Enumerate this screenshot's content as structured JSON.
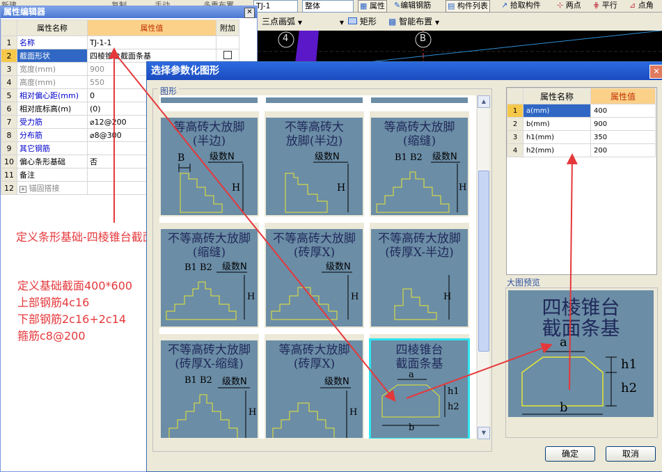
{
  "topbar": {
    "combo1": "TJ-1",
    "combo2": "整体",
    "attr_btn": "属性",
    "edit_rebar_btn": "编辑钢筋",
    "component_list_btn": "构件列表",
    "pick_component_btn": "拾取构件",
    "two_point_btn": "两点",
    "parallel_btn": "平行",
    "point_angle_btn": "点角",
    "left_partial": "新建",
    "col_partial_a": "复制",
    "col_partial_b": "手动",
    "col_partial_c": "多重布置"
  },
  "toolbar2": {
    "arc_combo": "三点画弧",
    "blank_combo": "",
    "rect_btn": "矩形",
    "smart_layout_btn": "智能布置"
  },
  "canvas": {
    "axis_a": "4",
    "axis_b": "B"
  },
  "prop_editor": {
    "title": "属性编辑器",
    "col_name": "属性名称",
    "col_value": "属性值",
    "col_extra": "附加",
    "rows": [
      {
        "n": "1",
        "name": "名称",
        "value": "TJ-1-1"
      },
      {
        "n": "2",
        "name": "截面形状",
        "value": "四棱锥台截面条基"
      },
      {
        "n": "3",
        "name": "宽度(mm)",
        "value": "900"
      },
      {
        "n": "4",
        "name": "高度(mm)",
        "value": "550"
      },
      {
        "n": "5",
        "name": "相对偏心距(mm)",
        "value": "0"
      },
      {
        "n": "6",
        "name": "相对底标高(m)",
        "value": "(0)"
      },
      {
        "n": "7",
        "name": "受力筋",
        "value": "⌀12@200"
      },
      {
        "n": "8",
        "name": "分布筋",
        "value": "⌀8@300"
      },
      {
        "n": "9",
        "name": "其它钢筋",
        "value": ""
      },
      {
        "n": "10",
        "name": "偏心条形基础",
        "value": "否"
      },
      {
        "n": "11",
        "name": "备注",
        "value": ""
      },
      {
        "n": "12",
        "name": "锚固搭接",
        "value": ""
      }
    ]
  },
  "notes": {
    "line1": "定义条形基础-四棱锥台截面条基",
    "line2": "定义基础截面400*600",
    "line3": "上部钢筋4c16",
    "line4": "下部钢筋2c16+2c14",
    "line5": "箍筋c8@200"
  },
  "dialog": {
    "title": "选择参数化图形",
    "group_label": "图形",
    "preview_label": "大图预览",
    "ok_btn": "确定",
    "cancel_btn": "取消",
    "shapes": [
      {
        "cap": "等高砖大放脚\n(半边)",
        "b": "B",
        "n": "级数N",
        "h": "H"
      },
      {
        "cap": "不等高砖大\n放脚(半边)",
        "b": "",
        "n": "级数N",
        "h": "H"
      },
      {
        "cap": "等高砖大放脚\n(缩缝)",
        "b": "B1 B2",
        "n": "级数N",
        "h": "H"
      },
      {
        "cap": "不等高砖大放脚\n(缩缝)",
        "b": "B1 B2",
        "n": "级数N",
        "h": "H"
      },
      {
        "cap": "不等高砖大放脚\n(砖厚X)",
        "b": "",
        "n": "级数N",
        "h": "H"
      },
      {
        "cap": "不等高砖大放脚\n(砖厚X-半边)",
        "b": "",
        "n": "",
        "h": "H"
      },
      {
        "cap": "不等高砖大放脚\n(砖厚X-缩缝)",
        "b": "B1 B2",
        "n": "级数N",
        "h": "H"
      },
      {
        "cap": "等高砖大放脚\n(砖厚X)",
        "b": "",
        "n": "级数N",
        "h": "H"
      },
      {
        "cap": "四棱锥台\n截面条基",
        "a": "a",
        "h1": "h1",
        "h2": "h2",
        "bb": "b"
      }
    ],
    "params": {
      "col_name": "属性名称",
      "col_value": "属性值",
      "rows": [
        {
          "n": "1",
          "name": "a(mm)",
          "value": "400"
        },
        {
          "n": "2",
          "name": "b(mm)",
          "value": "900"
        },
        {
          "n": "3",
          "name": "h1(mm)",
          "value": "350"
        },
        {
          "n": "4",
          "name": "h2(mm)",
          "value": "200"
        }
      ]
    },
    "preview": {
      "title": "四棱锥台\n截面条基",
      "a": "a",
      "b": "b",
      "h1": "h1",
      "h2": "h2"
    }
  },
  "colors": {
    "annotation_red": "#e5383b",
    "tile_bg": "#6b8da6",
    "selected_border": "#2fe5f0"
  }
}
